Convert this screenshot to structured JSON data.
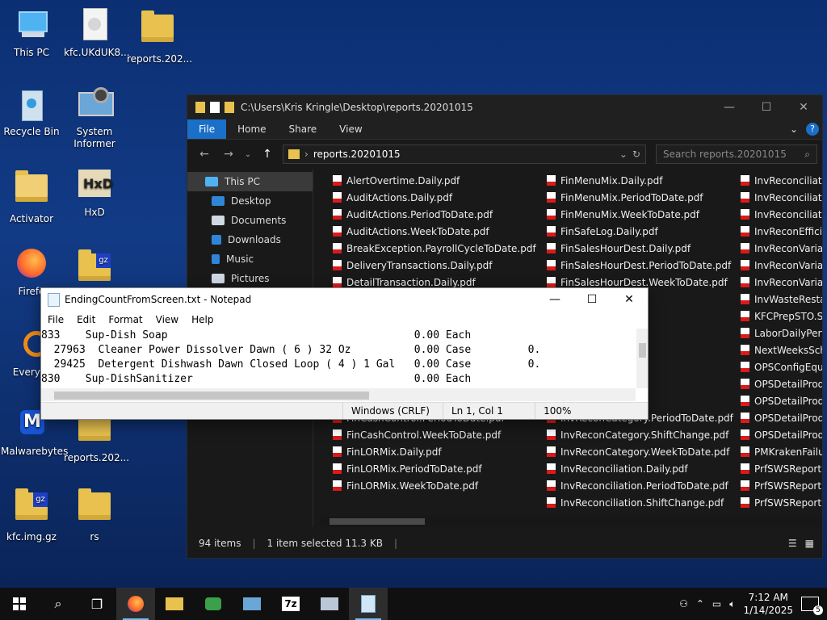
{
  "desktop": {
    "icons": [
      {
        "label": "This PC"
      },
      {
        "label": "kfc.UKdUK8..."
      },
      {
        "label": "reports.202..."
      },
      {
        "label": "Recycle Bin"
      },
      {
        "label": "System Informer"
      },
      {
        "label": "Activator"
      },
      {
        "label": "HxD"
      },
      {
        "label": "Firefo"
      },
      {
        "label": "Everyth"
      },
      {
        "label": "Malwarebytes"
      },
      {
        "label": "reports.202..."
      },
      {
        "label": "kfc.img.gz"
      },
      {
        "label": "rs"
      }
    ]
  },
  "explorer": {
    "title_path": "C:\\Users\\Kris Kringle\\Desktop\\reports.20201015",
    "ribbon_tabs": [
      "File",
      "Home",
      "Share",
      "View"
    ],
    "address_crumb": "reports.20201015",
    "search_placeholder": "Search reports.20201015",
    "sidebar": [
      "This PC",
      "Desktop",
      "Documents",
      "Downloads",
      "Music",
      "Pictures"
    ],
    "columns": [
      [
        "AlertOvertime.Daily.pdf",
        "AuditActions.Daily.pdf",
        "AuditActions.PeriodToDate.pdf",
        "AuditActions.WeekToDate.pdf",
        "BreakException.PayrollCycleToDate.pdf",
        "DeliveryTransactions.Daily.pdf",
        "DetailTransaction.Daily.pdf",
        "",
        "",
        "",
        "",
        "",
        "",
        "",
        "FinCashControl.PeriodToDate.pdf",
        "FinCashControl.WeekToDate.pdf",
        "FinLORMix.Daily.pdf",
        "FinLORMix.PeriodToDate.pdf",
        "FinLORMix.WeekToDate.pdf"
      ],
      [
        "FinMenuMix.Daily.pdf",
        "FinMenuMix.PeriodToDate.pdf",
        "FinMenuMix.WeekToDate.pdf",
        "FinSafeLog.Daily.pdf",
        "FinSalesHourDest.Daily.pdf",
        "FinSalesHourDest.PeriodToDate.pdf",
        "FinSalesHourDest.WeekToDate.pdf",
        "",
        "llCycleToDate.pdf",
        "s.Daily.pdf",
        "",
        "odf",
        "ly.pdf",
        "aily.pdf",
        "InvReconCategory.PeriodToDate.pdf",
        "InvReconCategory.ShiftChange.pdf",
        "InvReconCategory.WeekToDate.pdf",
        "InvReconciliation.Daily.pdf",
        "InvReconciliation.PeriodToDate.pdf",
        "InvReconciliation.ShiftChange.pdf"
      ],
      [
        "InvReconciliation",
        "InvReconciliatio",
        "InvReconciliatio",
        "InvReconEfficier",
        "InvReconVarianc",
        "InvReconVarianc",
        "InvReconVarianc",
        "InvWasteRestag",
        "KFCPrepSTO.Sta",
        "LaborDailyPerfD",
        "NextWeeksSche",
        "OPSConfigEquip",
        "OPSDetailProdu",
        "OPSDetailProdu",
        "OPSDetailProdu",
        "OPSDetailProdu",
        "PMKrakenFailur",
        "PrfSWSReport.D",
        "PrfSWSReport.P",
        "PrfSWSReport.W"
      ]
    ],
    "status": {
      "count": "94 items",
      "selected": "1 item selected  11.3 KB"
    }
  },
  "notepad": {
    "title": "EndingCountFromScreen.txt - Notepad",
    "menu": [
      "File",
      "Edit",
      "Format",
      "View",
      "Help"
    ],
    "lines": [
      "833    Sup-Dish Soap                                       0.00 Each",
      "  27963  Cleaner Power Dissolver Dawn ( 6 ) 32 Oz          0.00 Case         0.",
      "  29425  Detergent Dishwash Dawn Closed Loop ( 4 ) 1 Gal   0.00 Case         0.",
      "830    Sup-DishSanitizer                                   0.00 Each"
    ],
    "status": {
      "eol": "Windows (CRLF)",
      "pos": "Ln 1, Col 1",
      "zoom": "100%"
    }
  },
  "taskbar": {
    "time": "7:12 AM",
    "date": "1/14/2025",
    "notification_count": "5"
  }
}
